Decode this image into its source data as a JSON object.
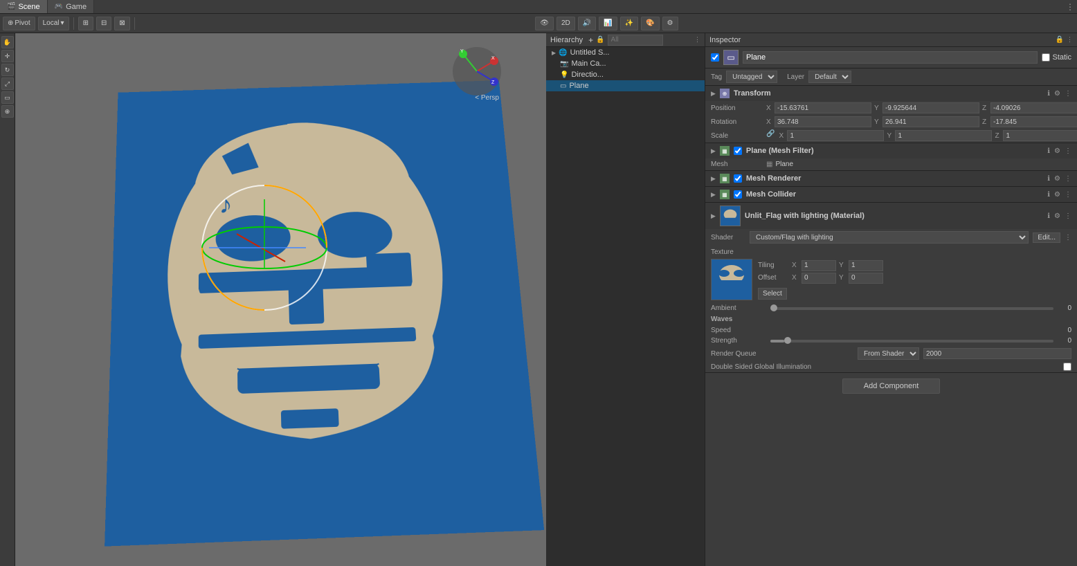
{
  "topTabs": [
    {
      "label": "Scene",
      "icon": "🎬",
      "active": true
    },
    {
      "label": "Game",
      "icon": "🎮",
      "active": false
    }
  ],
  "toolbar": {
    "pivot": "Pivot",
    "local": "Local",
    "mode2D": "2D",
    "playBtn": "▶",
    "pauseBtn": "⏸",
    "stepBtn": "⏭",
    "staticLabel": "Static"
  },
  "viewport": {
    "perspLabel": "< Persp"
  },
  "hierarchy": {
    "title": "Hierarchy",
    "searchPlaceholder": "All",
    "items": [
      {
        "label": "Untitled S...",
        "level": 0,
        "hasArrow": true,
        "icon": "🌐"
      },
      {
        "label": "Main Ca...",
        "level": 1,
        "hasArrow": false,
        "icon": "📷"
      },
      {
        "label": "Directio...",
        "level": 1,
        "hasArrow": false,
        "icon": "💡"
      },
      {
        "label": "Plane",
        "level": 1,
        "hasArrow": false,
        "icon": "▭",
        "selected": true
      }
    ]
  },
  "inspector": {
    "title": "Inspector",
    "objectName": "Plane",
    "staticLabel": "Static",
    "tagLabel": "Tag",
    "tagValue": "Untagged",
    "layerLabel": "Layer",
    "layerValue": "Default",
    "transform": {
      "title": "Transform",
      "positionLabel": "Position",
      "posX": "-15.63761",
      "posY": "-9.925644",
      "posZ": "-4.09026",
      "rotationLabel": "Rotation",
      "rotX": "36.748",
      "rotY": "26.941",
      "rotZ": "-17.845",
      "scaleLabel": "Scale",
      "scaleX": "1",
      "scaleY": "1",
      "scaleZ": "1"
    },
    "meshFilter": {
      "title": "Plane (Mesh Filter)",
      "meshLabel": "Mesh",
      "meshValue": "Plane"
    },
    "meshRenderer": {
      "title": "Mesh Renderer"
    },
    "meshCollider": {
      "title": "Mesh Collider"
    },
    "material": {
      "title": "Unlit_Flag with lighting (Material)",
      "shaderLabel": "Shader",
      "shaderValue": "Custom/Flag with lighting",
      "editLabel": "Edit...",
      "textureLabel": "Texture",
      "tilingLabel": "Tiling",
      "tilingX": "1",
      "tilingY": "1",
      "offsetLabel": "Offset",
      "offsetX": "0",
      "offsetY": "0",
      "selectLabel": "Select",
      "ambientLabel": "Ambient",
      "ambientValue": "0",
      "ambientFill": "0",
      "wavesLabel": "Waves",
      "speedLabel": "Speed",
      "speedValue": "0",
      "strengthLabel": "Strength",
      "strengthValue": "0",
      "strengthFill": "5",
      "renderQueueLabel": "Render Queue",
      "renderQueueOption": "From Shader",
      "renderQueueValue": "2000",
      "doubleSidedLabel": "Double Sided Global Illumination"
    },
    "addComponentLabel": "Add Component"
  }
}
